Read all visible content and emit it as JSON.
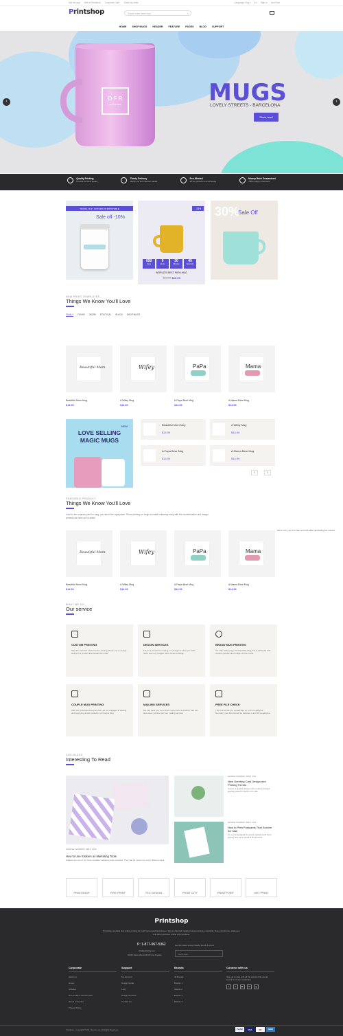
{
  "topbar": {
    "links": [
      "Get the app",
      "Sell on Printshop",
      "Customer Care",
      "Track my order"
    ],
    "right": [
      "Language: Eng ▾",
      "$ ▾",
      "Sign in",
      "Join Free"
    ]
  },
  "logo": {
    "prefix": "P",
    "text": "rintshop"
  },
  "search": {
    "placeholder": "Search entire store here..."
  },
  "nav": [
    "HOME",
    "SHOP MUGS",
    "HEADER",
    "FEATURE",
    "PAGES",
    "BLOG",
    "SUPPORT"
  ],
  "hero": {
    "title": "MUGS",
    "subtitle": "LOVELY STREETS - BARCELONA",
    "button": "Show now!",
    "mug_mark": "D F R",
    "mug_sub": "MUG'S ONE"
  },
  "features": [
    {
      "t": "Quality Printing",
      "s": "Provide the best quality"
    },
    {
      "t": "Timely Delivery",
      "s": "Always on time without hassle"
    },
    {
      "t": "Eco-Minded",
      "s": "All our product is eco-friendly"
    },
    {
      "t": "Money Back Guaranteed",
      "s": "100% happy customers"
    }
  ],
  "promo": {
    "left_tag": "TRAVEL CUP - NOTHING IS IMPOSSIBLE",
    "left_sale": "Sale off -10%",
    "badge": "- 33%",
    "countdown": [
      {
        "n": "658",
        "l": "Days"
      },
      {
        "n": "9",
        "l": "Hours"
      },
      {
        "n": "30",
        "l": "Minutes"
      },
      {
        "n": "49",
        "l": "Seconds"
      }
    ],
    "mid_name": "WORLD'S BEST PAPA MUG",
    "mid_old": "$14.99",
    "mid_new": "$10.00",
    "right_pct": "30%",
    "right_sale": "Sale Off"
  },
  "section1": {
    "sub": "NEW PRINT TEMPLATES",
    "title": "Things We Know You'll Love",
    "tabs": [
      "FAMILY",
      "FUNNY",
      "WORK",
      "POLITICAL",
      "BLACK",
      "SHOP MUGS"
    ]
  },
  "products": [
    {
      "name": "Beautiful Mom Mug",
      "price": "$14.99",
      "art": "Beautiful Mom"
    },
    {
      "name": "A Wifey Mug",
      "price": "$14.99",
      "art": "Wifey"
    },
    {
      "name": "A Papa Bear Mug",
      "price": "$14.99",
      "art": "PaPa"
    },
    {
      "name": "A Mama Bear Mug",
      "price": "$14.99",
      "art": "Mama"
    }
  ],
  "magic": {
    "tag": "NEW",
    "line1": "LOVE SELLING",
    "line2": "MAGIC MUGS"
  },
  "minilist": [
    {
      "name": "Beautiful Mom Mug",
      "price": "$14.99"
    },
    {
      "name": "A Wifey Mug",
      "price": "$14.99"
    },
    {
      "name": "A Papa Bear Mug",
      "price": "$14.99"
    },
    {
      "name": "A Mama Bear Mug",
      "price": "$14.99"
    }
  ],
  "section2": {
    "sub": "FEATURED PRODUCT",
    "title": "Things We Know You'll Love",
    "desc": "Love to see a photo print on mug, you are in the right place. Photo printing on mugs is made extremely easy with the customization and design process we have put in place.",
    "error": "We're sorry, an error has occurred while generating this content."
  },
  "section3": {
    "sub": "WHAT WE DO",
    "title": "Our service"
  },
  "services": [
    {
      "t": "CUSTOM PRINTING",
      "p": "Skip the standard stuff! Custom printing allows you to design and print a product that breaks the mold."
    },
    {
      "t": "DESIGN SERVICES",
      "p": "Fill out a simple form telling our designers what you'd like. Send over any images. We'll create a design."
    },
    {
      "t": "BRAND MUG PRINTING",
      "p": "We offer wide range Printed White Mug that is delivered with creative pictures and images of the brand."
    },
    {
      "t": "COUPLE MUG PRINTING",
      "p": "With our professional experience, we are engaged in trading and supplying a wide collection of Couple Mug."
    },
    {
      "t": "MAILING SERVICES",
      "p": "We can save you more than money here at PsPrint. We can also save you time with our mailing services"
    },
    {
      "t": "FREE FILE CHECK",
      "p": "This tool will let you upload files up to 64 megabytes. Normally, your files should be between 1 and 10 megabytes."
    }
  ],
  "section4": {
    "sub": "OUR BLOGS",
    "title": "Interesting To Read"
  },
  "blog_main": {
    "meta": "GEORGE SANDERS / FEB 2, 2016",
    "title": "How to Use Stickers as Marketing Tools",
    "desc": "Stickers are one of the most versatile marketing tools out there. They can be used in so many different ways..."
  },
  "blog_side": [
    {
      "meta": "GEORGE SANDERS / FEB 2, 2016",
      "title": "New Greeting Card Design and Printing Trends",
      "desc": "If you're a graphic designer who routinely designs greeting cards for clients or for sale"
    },
    {
      "meta": "GEORGE SANDERS / FEB 2, 2016",
      "title": "How to Print Postcards That Survive the Mail",
      "desc": "So, you've designed the perfect postcard and had it printed, and you're proud of this sure-fire"
    }
  ],
  "brands": [
    "PRINTSHOP",
    "FIRE PRINT",
    "TEC DESIGN",
    "PRINT CITY",
    "PRINTPOINT",
    "ART PRINT"
  ],
  "footer": {
    "about": "Printshop provides fast online printing for both homes and businesses. We provide high quality business cards, postcards, flyers, brochures, stationery and other premium online print products.",
    "phone": "P: 1-877-967-5362",
    "email": "info@printshop.net",
    "address": "92040 Santa Monica BLVD Los Angeles",
    "newsletter": "Get the latest scoop! Deals, trends & more!",
    "nl_placeholder": "Your Email...",
    "copy": "Printshop - Copyright © 2017 Zemez.net. All Rights Reserved.",
    "payments": [
      "PayPal",
      "VISA",
      "MC",
      "AMEX"
    ]
  },
  "fcols": [
    {
      "title": "Corporate",
      "items": [
        "About us",
        "Green",
        "Affiliates",
        "Non-profits & Government",
        "Terms of Service",
        "Privacy Policy"
      ]
    },
    {
      "title": "Support",
      "items": [
        "My Account",
        "Design Guide",
        "FAQ",
        "Design Services",
        "Contact Us"
      ]
    },
    {
      "title": "Brands",
      "items": [
        "All Brands",
        "Brands 1",
        "Brands 2",
        "Brands 3",
        "Brands 4"
      ]
    },
    {
      "title": "Connect with us",
      "items": [
        "Stay up to date with all the actions that we are saved for all our customers."
      ]
    }
  ],
  "colors": {
    "accent": "#5b4fd8",
    "dark": "#2a2a2c",
    "heroBg": "#e4e4e6"
  }
}
